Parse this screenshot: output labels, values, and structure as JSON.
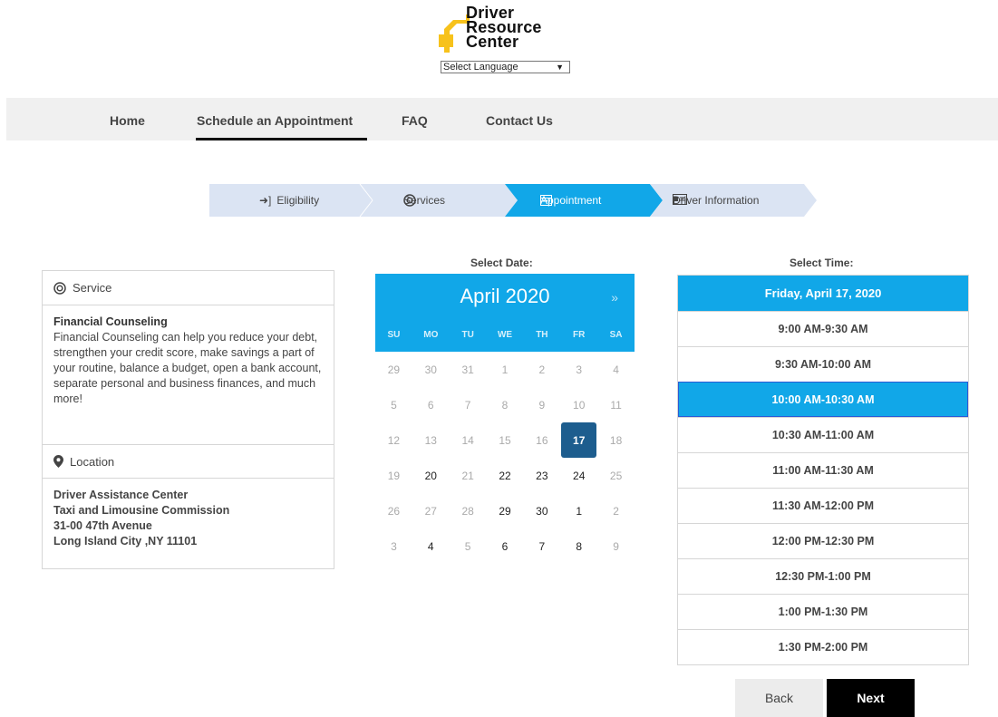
{
  "brand": {
    "logo_lines": [
      "Driver",
      "Resource",
      "Center"
    ],
    "language_select": "Select Language"
  },
  "nav": {
    "items": [
      {
        "label": "Home"
      },
      {
        "label": "Schedule an Appointment",
        "active": true
      },
      {
        "label": "FAQ"
      },
      {
        "label": "Contact Us"
      }
    ]
  },
  "stepper": {
    "steps": [
      {
        "label": "Eligibility",
        "icon": "sign-in-icon"
      },
      {
        "label": "Services",
        "icon": "life-ring-icon"
      },
      {
        "label": "Appointment",
        "icon": "calendar-icon",
        "active": true
      },
      {
        "label": "Driver Information",
        "icon": "id-card-icon"
      }
    ]
  },
  "service_panel": {
    "service_header": "Service",
    "service_title": "Financial Counseling",
    "service_desc": "Financial Counseling can help you reduce your debt, strengthen your credit score, make savings a part of your routine, balance a budget, open a bank account, separate personal and business finances, and much more!",
    "location_header": "Location",
    "location_lines": [
      "Driver Assistance Center",
      "Taxi and Limousine Commission",
      "31-00 47th Avenue",
      "Long Island City ,NY 11101"
    ]
  },
  "calendar": {
    "section_title": "Select Date:",
    "month": "April 2020",
    "next": "»",
    "dows": [
      "SU",
      "MO",
      "TU",
      "WE",
      "TH",
      "FR",
      "SA"
    ],
    "weeks": [
      [
        {
          "d": "29"
        },
        {
          "d": "30"
        },
        {
          "d": "31"
        },
        {
          "d": "1"
        },
        {
          "d": "2"
        },
        {
          "d": "3"
        },
        {
          "d": "4"
        }
      ],
      [
        {
          "d": "5"
        },
        {
          "d": "6"
        },
        {
          "d": "7"
        },
        {
          "d": "8"
        },
        {
          "d": "9"
        },
        {
          "d": "10"
        },
        {
          "d": "11"
        }
      ],
      [
        {
          "d": "12"
        },
        {
          "d": "13"
        },
        {
          "d": "14"
        },
        {
          "d": "15"
        },
        {
          "d": "16"
        },
        {
          "d": "17",
          "sel": true
        },
        {
          "d": "18"
        }
      ],
      [
        {
          "d": "19"
        },
        {
          "d": "20",
          "a": true
        },
        {
          "d": "21"
        },
        {
          "d": "22",
          "a": true
        },
        {
          "d": "23",
          "a": true
        },
        {
          "d": "24",
          "a": true
        },
        {
          "d": "25"
        }
      ],
      [
        {
          "d": "26"
        },
        {
          "d": "27"
        },
        {
          "d": "28"
        },
        {
          "d": "29",
          "a": true
        },
        {
          "d": "30",
          "a": true
        },
        {
          "d": "1",
          "a": true
        },
        {
          "d": "2"
        }
      ],
      [
        {
          "d": "3"
        },
        {
          "d": "4",
          "a": true
        },
        {
          "d": "5"
        },
        {
          "d": "6",
          "a": true
        },
        {
          "d": "7",
          "a": true
        },
        {
          "d": "8",
          "a": true
        },
        {
          "d": "9"
        }
      ]
    ]
  },
  "time": {
    "section_title": "Select Time:",
    "date_header": "Friday, April 17, 2020",
    "slots": [
      {
        "label": "9:00 AM-9:30 AM"
      },
      {
        "label": "9:30 AM-10:00 AM"
      },
      {
        "label": "10:00 AM-10:30 AM",
        "sel": true
      },
      {
        "label": "10:30 AM-11:00 AM"
      },
      {
        "label": "11:00 AM-11:30 AM"
      },
      {
        "label": "11:30 AM-12:00 PM"
      },
      {
        "label": "12:00 PM-12:30 PM"
      },
      {
        "label": "12:30 PM-1:00 PM"
      },
      {
        "label": "1:00 PM-1:30 PM"
      },
      {
        "label": "1:30 PM-2:00 PM"
      }
    ]
  },
  "buttons": {
    "back": "Back",
    "next": "Next"
  },
  "colors": {
    "accent": "#11a7e8",
    "selected_day": "#1d5d8e",
    "step_inactive": "#dbe4f3",
    "logo_yellow": "#f7c21b"
  }
}
